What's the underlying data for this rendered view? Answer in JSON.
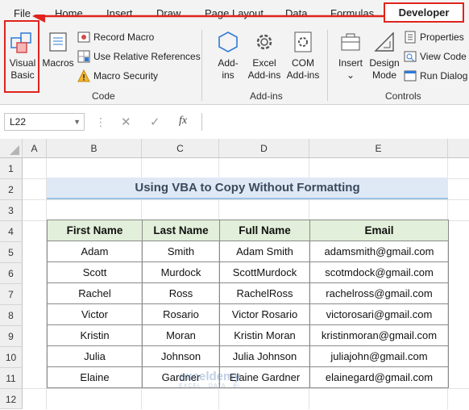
{
  "tabs": [
    "File",
    "Home",
    "Insert",
    "Draw",
    "Page Layout",
    "Data",
    "Formulas"
  ],
  "active_tab": "Developer",
  "ribbon": {
    "code": {
      "visual_basic": [
        "Visual",
        "Basic"
      ],
      "macros": "Macros",
      "record_macro": "Record Macro",
      "use_relative": "Use Relative References",
      "macro_security": "Macro Security",
      "label": "Code"
    },
    "addins": {
      "addins": [
        "Add-",
        "ins"
      ],
      "excel_addins": [
        "Excel",
        "Add-ins"
      ],
      "com_addins": [
        "COM",
        "Add-ins"
      ],
      "label": "Add-ins"
    },
    "controls": {
      "insert": "Insert",
      "design_mode": [
        "Design",
        "Mode"
      ],
      "properties": "Properties",
      "view_code": "View Code",
      "run_dialog": "Run Dialog",
      "label": "Controls"
    }
  },
  "formula_bar": {
    "name_box": "L22",
    "fx": "fx"
  },
  "columns": [
    "A",
    "B",
    "C",
    "D",
    "E"
  ],
  "rows": [
    "1",
    "2",
    "3",
    "4",
    "5",
    "6",
    "7",
    "8",
    "9",
    "10",
    "11",
    "12"
  ],
  "sheet": {
    "title": "Using VBA to Copy Without Formatting",
    "headers": [
      "First Name",
      "Last Name",
      "Full Name",
      "Email"
    ],
    "rows": [
      [
        "Adam",
        "Smith",
        "Adam Smith",
        "adamsmith@gmail.com"
      ],
      [
        "Scott",
        "Murdock",
        "ScottMurdock",
        "scotmdock@gmail.com"
      ],
      [
        "Rachel",
        "Ross",
        "RachelRoss",
        "rachelross@gmail.com"
      ],
      [
        "Victor",
        "Rosario",
        "Victor Rosario",
        "victorosari@gmail.com"
      ],
      [
        "Kristin",
        "Moran",
        "Kristin Moran",
        "kristinmoran@gmail.com"
      ],
      [
        "Julia",
        "Johnson",
        "Julia Johnson",
        "juliajohn@gmail.com"
      ],
      [
        "Elaine",
        "Gardner",
        "Elaine Gardner",
        "elainegard@gmail.com"
      ]
    ]
  },
  "watermark": {
    "brand": "exceldemy",
    "tagline": "EXCEL · DATA · BI"
  },
  "colors": {
    "highlight": "#e0231c",
    "header_fill": "#e2efda",
    "title_fill": "#dfe9f5"
  }
}
